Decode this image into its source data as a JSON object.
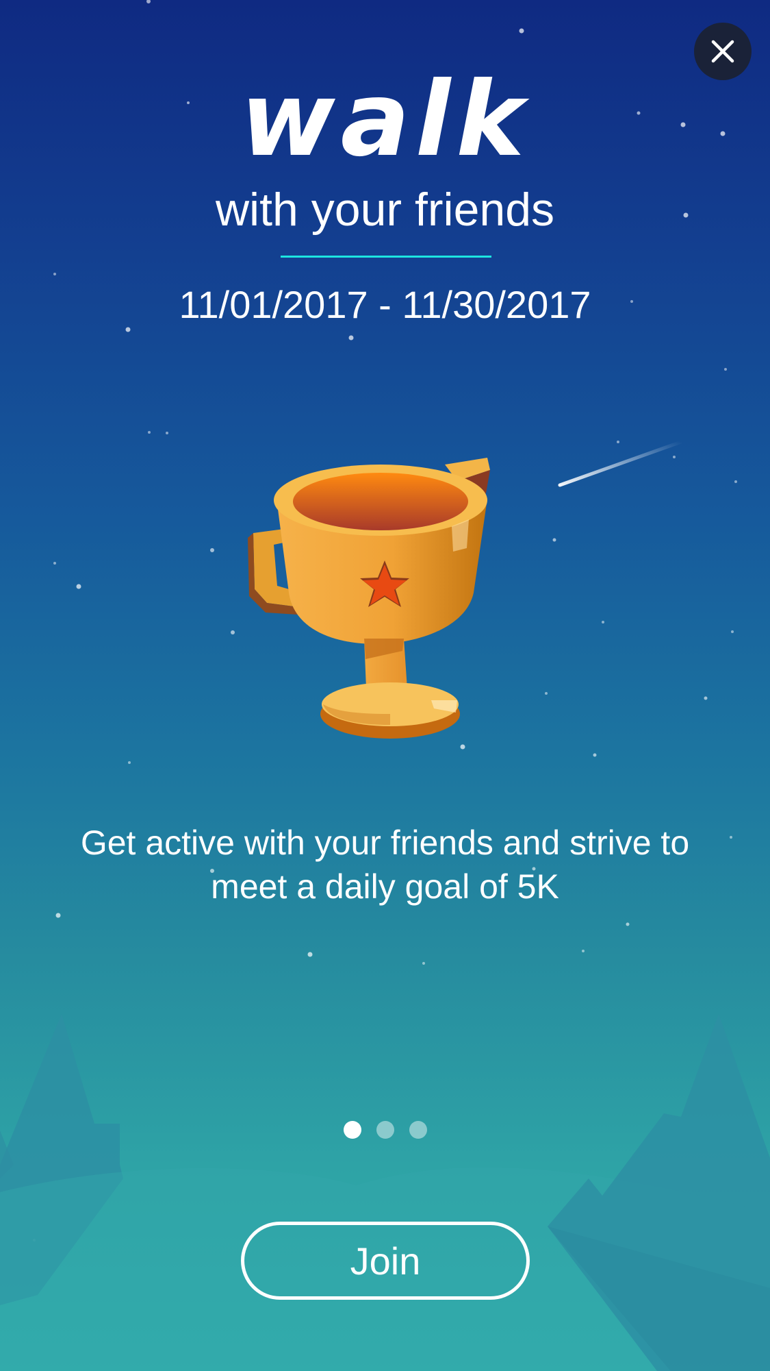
{
  "hero": {
    "headline": "walk",
    "subheadline": "with your friends",
    "date_range": "11/01/2017 - 11/30/2017"
  },
  "description": "Get active with your friends and strive to meet a daily goal of 5K",
  "pager": {
    "total": 3,
    "active_index": 0
  },
  "join_button": {
    "label": "Join"
  },
  "icons": {
    "close": "close-icon",
    "trophy": "trophy-icon"
  },
  "colors": {
    "divider": "#1de6e0",
    "close_button_bg": "#1a2238",
    "trophy_gold": "#f2a93b",
    "trophy_star": "#e84a12"
  }
}
